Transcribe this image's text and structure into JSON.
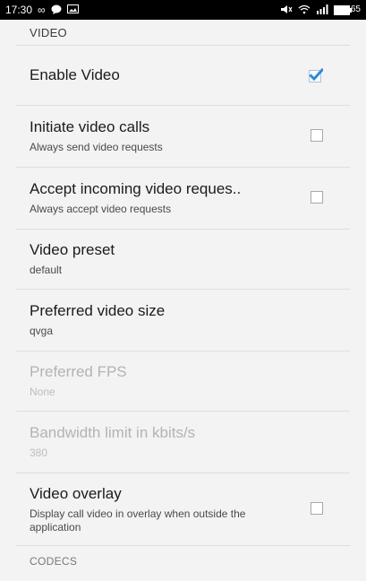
{
  "status_bar": {
    "time": "17:30",
    "left_icons": [
      "infinity-icon",
      "chat-bubble-icon",
      "image-icon"
    ],
    "right_icons": [
      "mute-icon",
      "wifi-icon",
      "signal-icon"
    ],
    "battery": "65"
  },
  "sections": {
    "video_header": "VIDEO",
    "codecs_header": "CODECS"
  },
  "prefs": {
    "enable_video": {
      "title": "Enable Video",
      "checked": true
    },
    "initiate_calls": {
      "title": "Initiate video calls",
      "summary": "Always send video requests",
      "checked": false
    },
    "accept_incoming": {
      "title": "Accept incoming video reques..",
      "summary": "Always accept video requests",
      "checked": false
    },
    "video_preset": {
      "title": "Video preset",
      "summary": "default"
    },
    "video_size": {
      "title": "Preferred video size",
      "summary": "qvga"
    },
    "fps": {
      "title": "Preferred FPS",
      "summary": "None",
      "enabled": false
    },
    "bandwidth": {
      "title": "Bandwidth limit in kbits/s",
      "summary": "380",
      "enabled": false
    },
    "overlay": {
      "title": "Video overlay",
      "summary": "Display call video in overlay when outside the application",
      "checked": false
    }
  },
  "colors": {
    "accent": "#2f8ad6",
    "background": "#f3f3f3"
  }
}
